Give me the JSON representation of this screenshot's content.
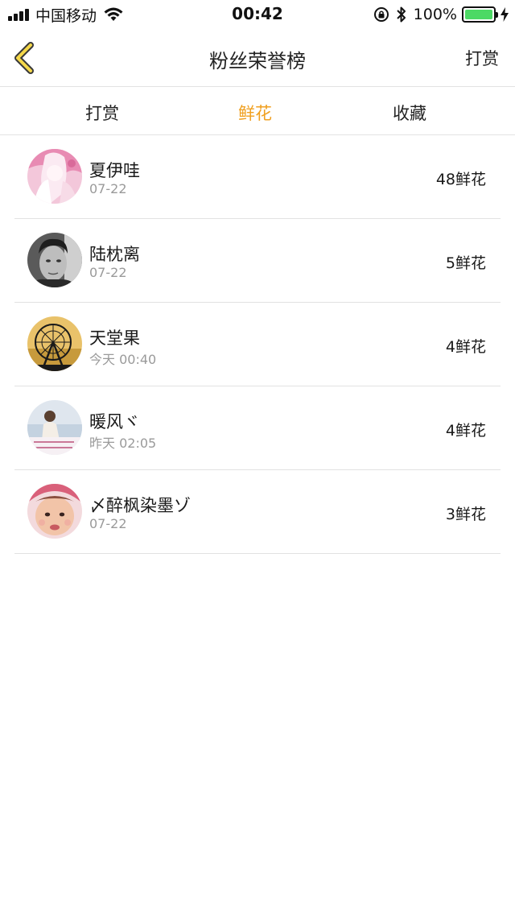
{
  "status_bar": {
    "carrier": "中国移动",
    "time": "00:42",
    "battery_percent": "100%",
    "battery_level": 1.0,
    "battery_color": "#4cd964"
  },
  "nav": {
    "back_icon": "chevron-left-icon",
    "title": "粉丝荣誉榜",
    "action_label": "打赏"
  },
  "tabs": [
    {
      "label": "打赏",
      "active": false
    },
    {
      "label": "鲜花",
      "active": true
    },
    {
      "label": "收藏",
      "active": false
    }
  ],
  "accent_color": "#f0a020",
  "fans": [
    {
      "name": "夏伊哇",
      "time": "07-22",
      "count": "48鲜花",
      "avatar": "anime-girl-pink"
    },
    {
      "name": "陆枕离",
      "time": "07-22",
      "count": "5鲜花",
      "avatar": "man-portrait-bw"
    },
    {
      "name": "天堂果",
      "time": "今天 00:40",
      "count": "4鲜花",
      "avatar": "ferris-wheel"
    },
    {
      "name": "暖风ヾ",
      "time": "昨天 02:05",
      "count": "4鲜花",
      "avatar": "girl-seaside"
    },
    {
      "name": "〆醉枫染墨ゾ",
      "time": "07-22",
      "count": "3鲜花",
      "avatar": "baby-face"
    }
  ]
}
